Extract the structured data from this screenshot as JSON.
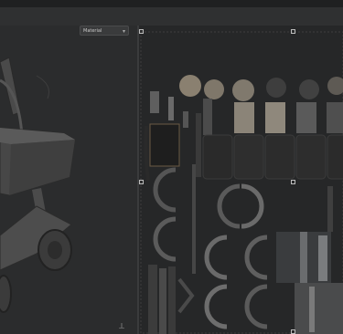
{
  "toolbar": {
    "material_dropdown": {
      "value": "Material",
      "icon": "chevron-down-icon"
    }
  },
  "viewport": {
    "subject": "3d-cart-model"
  },
  "uv_editor": {
    "handles": "transform-handles"
  },
  "icons": {
    "navigation": "navigation-gizmo-icon"
  }
}
